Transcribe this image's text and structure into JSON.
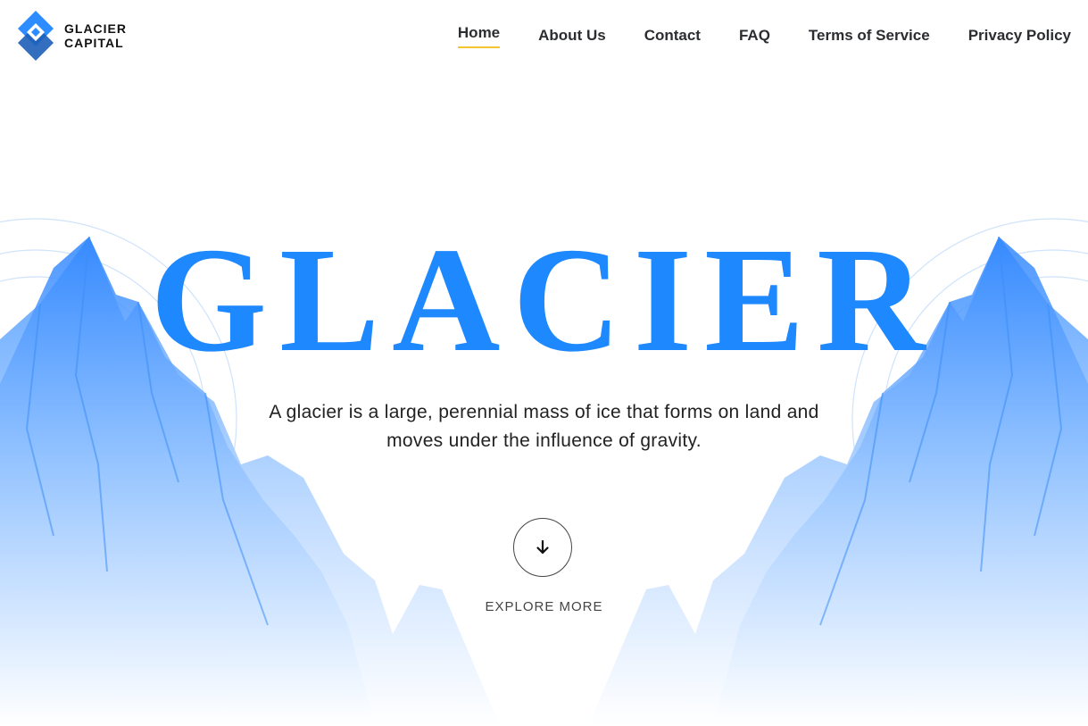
{
  "brand": {
    "line1": "GLACIER",
    "line2": "CAPITAL"
  },
  "nav": {
    "items": [
      {
        "label": "Home",
        "active": true
      },
      {
        "label": "About Us"
      },
      {
        "label": "Contact"
      },
      {
        "label": "FAQ"
      },
      {
        "label": "Terms of Service"
      },
      {
        "label": "Privacy Policy"
      }
    ]
  },
  "hero": {
    "title": "GLACIER",
    "subtitle": "A glacier is a large, perennial mass of ice that forms on land and moves under the influence of gravity.",
    "explore_label": "EXPLORE MORE"
  },
  "colors": {
    "accent": "#1e88ff",
    "nav_underline": "#f5c531",
    "nav_text": "#2b2d30"
  },
  "icons": {
    "logo": "diamond-logo-icon",
    "explore": "arrow-down-icon",
    "background": "mountains-illustration"
  }
}
